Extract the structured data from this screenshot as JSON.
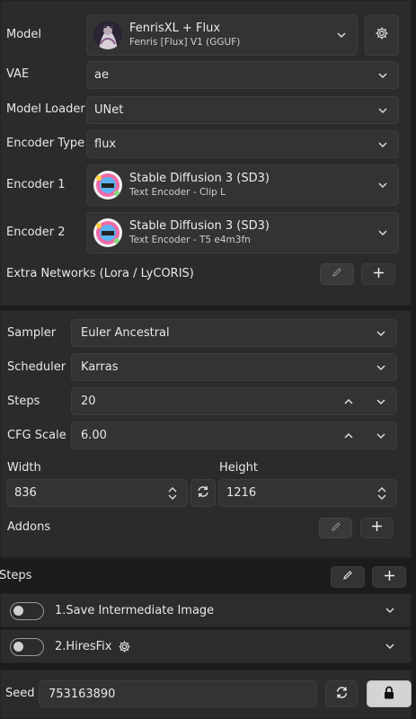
{
  "model": {
    "label": "Model",
    "name": "FenrisXL + Flux",
    "sub": "Fenris [Flux] V1 (GGUF)"
  },
  "vae": {
    "label": "VAE",
    "value": "ae"
  },
  "model_loader": {
    "label": "Model Loader",
    "value": "UNet"
  },
  "encoder_type": {
    "label": "Encoder Type",
    "value": "flux"
  },
  "encoder1": {
    "label": "Encoder 1",
    "name": "Stable Diffusion 3 (SD3)",
    "sub": "Text Encoder - Clip L"
  },
  "encoder2": {
    "label": "Encoder 2",
    "name": "Stable Diffusion 3 (SD3)",
    "sub": "Text Encoder - T5 e4m3fn"
  },
  "extra_networks": {
    "label": "Extra Networks (Lora / LyCORIS)"
  },
  "sampler": {
    "label": "Sampler",
    "value": "Euler Ancestral"
  },
  "scheduler": {
    "label": "Scheduler",
    "value": "Karras"
  },
  "steps": {
    "label": "Steps",
    "value": "20"
  },
  "cfg": {
    "label": "CFG Scale",
    "value": "6.00"
  },
  "width": {
    "label": "Width",
    "value": "836"
  },
  "height": {
    "label": "Height",
    "value": "1216"
  },
  "addons": {
    "label": "Addons"
  },
  "steps_section": {
    "label": "Steps",
    "items": [
      {
        "label": "1.Save Intermediate Image"
      },
      {
        "label": "2.HiresFix"
      }
    ]
  },
  "seed": {
    "label": "Seed",
    "value": "753163890"
  },
  "colors": {
    "bg": "#1c1c1c",
    "panel": "#2b2b2b",
    "field": "#333333",
    "lock": "#d4d4d4"
  }
}
